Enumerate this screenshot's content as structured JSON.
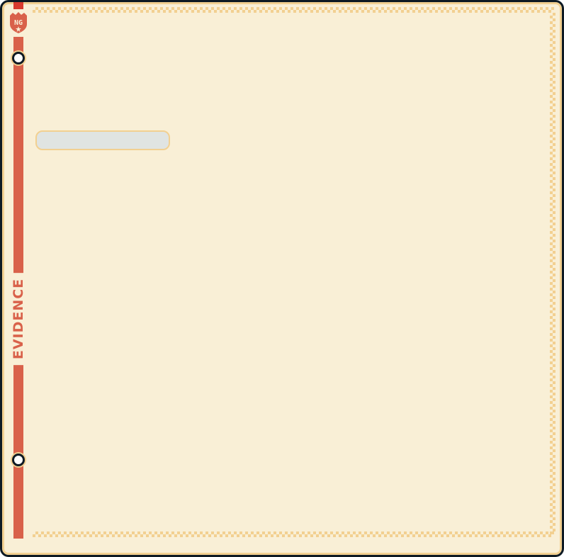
{
  "sidebar": {
    "label": "EVIDENCE",
    "logo_text": "NG",
    "logo_icon": "shield-star-icon"
  },
  "main": {
    "field_value": ""
  },
  "colors": {
    "accent": "#d9614a",
    "background": "#f9efd6",
    "border": "#f2d091",
    "frame": "#0e1a24",
    "field": "#e0e4e2"
  }
}
